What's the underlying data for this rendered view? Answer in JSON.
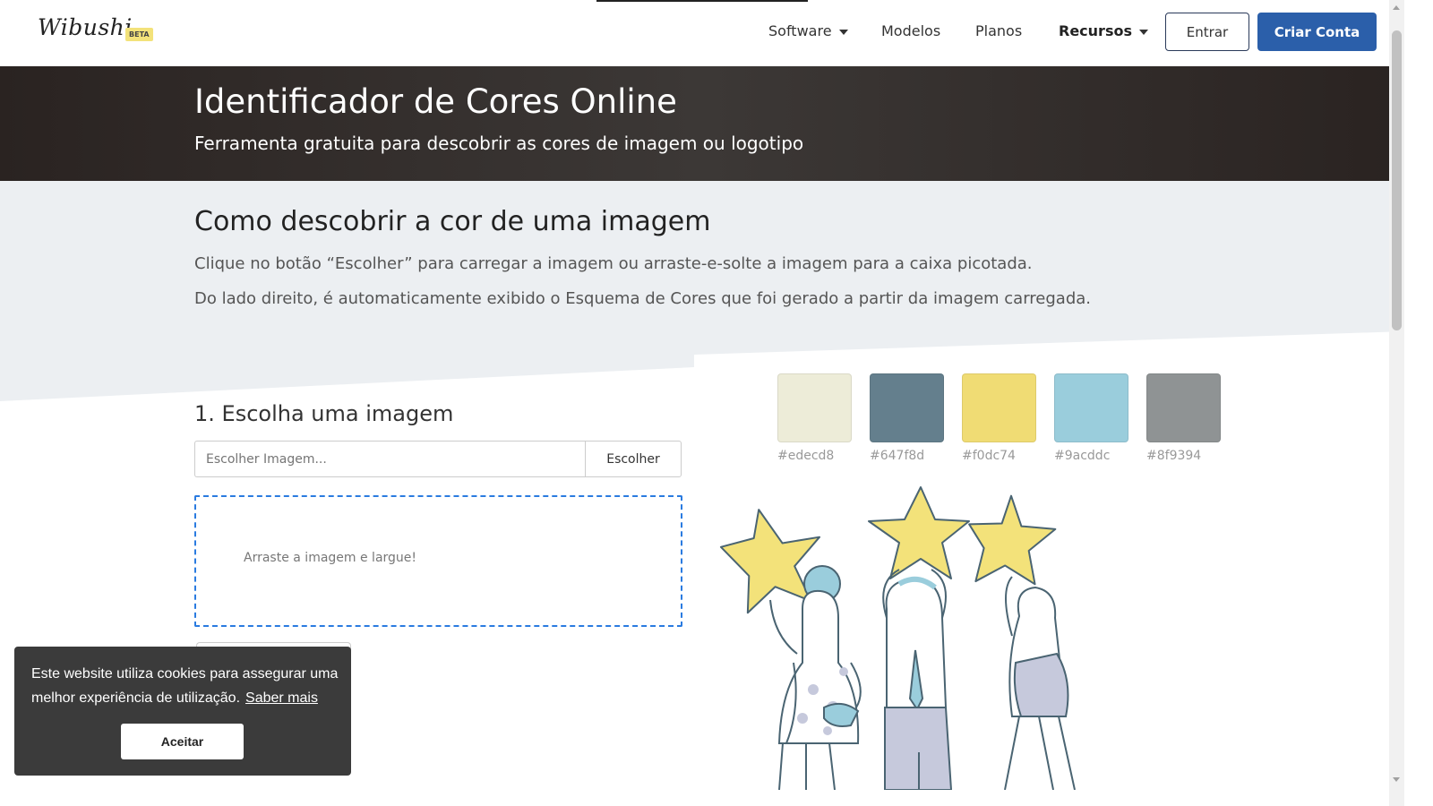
{
  "header": {
    "logo": "Wibushi",
    "beta_badge": "BETA",
    "nav": [
      {
        "label": "Software"
      },
      {
        "label": "Modelos"
      },
      {
        "label": "Planos"
      },
      {
        "label": "Recursos"
      }
    ],
    "login_label": "Entrar",
    "signup_label": "Criar Conta"
  },
  "hero": {
    "title": "Identificador de Cores Online",
    "subtitle": "Ferramenta gratuita para descobrir as cores de imagem ou logotipo"
  },
  "howto": {
    "title": "Como descobrir a cor de uma imagem",
    "paragraphs": [
      "Clique no botão “Escolher” para carregar a imagem ou arraste-e-solte a imagem para a caixa picotada.",
      "Do lado direito, é automaticamente exibido o Esquema de Cores que foi gerado a partir da imagem carregada."
    ]
  },
  "upload": {
    "step_title": "1. Escolha uma imagem",
    "placeholder": "Escolher Imagem...",
    "choose_label": "Escolher",
    "dropzone_text": "Arraste a imagem e largue!"
  },
  "palette": [
    {
      "hex": "#edecd8",
      "label": "#edecd8"
    },
    {
      "hex": "#647f8d",
      "label": "#647f8d"
    },
    {
      "hex": "#f0dc74",
      "label": "#f0dc74"
    },
    {
      "hex": "#9acddc",
      "label": "#9acddc"
    },
    {
      "hex": "#8f9394",
      "label": "#8f9394"
    }
  ],
  "cookie": {
    "text": "Este website utiliza cookies para assegurar uma melhor experiência de utilização.",
    "link": "Saber mais",
    "accept": "Aceitar"
  },
  "colors": {
    "primary": "#2b5faa",
    "hero_bg": "#2f2927",
    "section_bg": "#eceff2",
    "dropzone_border": "#2a7be0",
    "cookie_bg": "#3b3b3b"
  }
}
